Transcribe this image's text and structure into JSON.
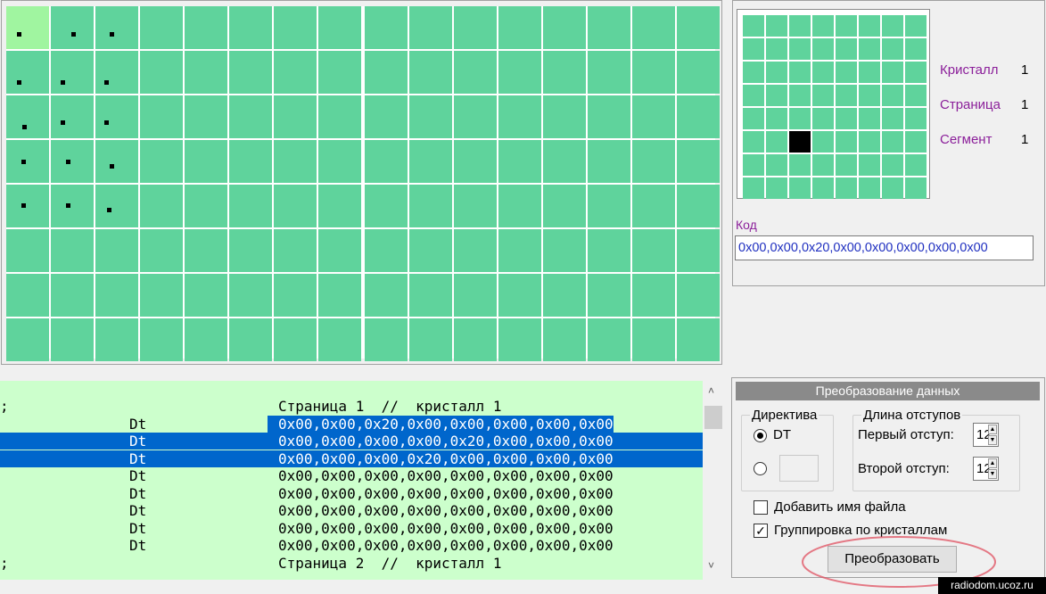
{
  "pixel_grid": {
    "cols": 16,
    "rows": 8,
    "highlighted_cell": {
      "row": 0,
      "col": 0
    }
  },
  "segment_grid": {
    "cols": 8,
    "rows": 8,
    "selected": {
      "row": 5,
      "col": 2
    }
  },
  "info": {
    "crystal_label": "Кристалл",
    "crystal_value": "1",
    "page_label": "Страница",
    "page_value": "1",
    "segment_label": "Сегмент",
    "segment_value": "1"
  },
  "code": {
    "label": "Код",
    "value": "0x00,0x00,0x20,0x00,0x00,0x00,0x00,0x00"
  },
  "listing": {
    "lines": [
      {
        "prefix": ";",
        "mid": "",
        "text": "Страница 1  //  кристалл 1",
        "selected": false
      },
      {
        "prefix": "",
        "mid": "Dt",
        "text": "0x00,0x00,0x20,0x00,0x00,0x00,0x00,0x00",
        "selected": "partial"
      },
      {
        "prefix": "",
        "mid": "Dt",
        "text": "0x00,0x00,0x00,0x00,0x20,0x00,0x00,0x00",
        "selected": true
      },
      {
        "prefix": "",
        "mid": "Dt",
        "text": "0x00,0x00,0x00,0x20,0x00,0x00,0x00,0x00",
        "selected": true
      },
      {
        "prefix": "",
        "mid": "Dt",
        "text": "0x00,0x00,0x00,0x00,0x00,0x00,0x00,0x00",
        "selected": false
      },
      {
        "prefix": "",
        "mid": "Dt",
        "text": "0x00,0x00,0x00,0x00,0x00,0x00,0x00,0x00",
        "selected": false
      },
      {
        "prefix": "",
        "mid": "Dt",
        "text": "0x00,0x00,0x00,0x00,0x00,0x00,0x00,0x00",
        "selected": false
      },
      {
        "prefix": "",
        "mid": "Dt",
        "text": "0x00,0x00,0x00,0x00,0x00,0x00,0x00,0x00",
        "selected": false
      },
      {
        "prefix": "",
        "mid": "Dt",
        "text": "0x00,0x00,0x00,0x00,0x00,0x00,0x00,0x00",
        "selected": false
      },
      {
        "prefix": ";",
        "mid": "",
        "text": "Страница 2  //  кристалл 1",
        "selected": false
      }
    ]
  },
  "convert": {
    "title": "Преобразование данных",
    "directive_label": "Директива",
    "directive_dt": "DT",
    "directive_dt_selected": true,
    "directive_custom_value": "",
    "indent_label": "Длина отступов",
    "first_indent_label": "Первый отступ:",
    "first_indent_value": "12",
    "second_indent_label": "Второй отступ:",
    "second_indent_value": "12",
    "add_filename_label": "Добавить имя файла",
    "add_filename_checked": false,
    "group_by_crystal_label": "Группировка по кристаллам",
    "group_by_crystal_checked": true,
    "convert_button": "Преобразовать"
  },
  "watermark": "radiodom.ucoz.ru",
  "colors": {
    "cell": "#5fd39c",
    "cell_highlight": "#a0f5a0",
    "listing_bg": "#ccffcc",
    "selection": "#0066cc",
    "label_purple": "#8b1f9a"
  }
}
